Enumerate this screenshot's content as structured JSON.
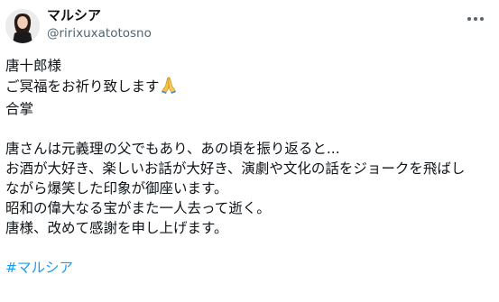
{
  "author": {
    "display_name": "マルシア",
    "handle": "@ririxuxatotosno"
  },
  "post": {
    "lines": [
      "唐十郎様",
      "ご冥福をお祈り致します",
      "合掌",
      "唐さんは元義理の父でもあり、あの頃を振り返ると...",
      "お酒が大好き、楽しいお話が大好き、演劇や文化の話をジョークを飛ばし",
      "ながら爆笑した印象が御座います。",
      "昭和の偉大なる宝がまた一人去って逝く。",
      "唐様、改めて感謝を申し上げます。"
    ],
    "emoji": "folded-hands",
    "hashtag": "#マルシア"
  },
  "icons": {
    "more": "more-horizontal-icon",
    "emoji": "folded-hands-icon"
  },
  "colors": {
    "text": "#0f1419",
    "secondary": "#536471",
    "link": "#1d9bf0"
  }
}
